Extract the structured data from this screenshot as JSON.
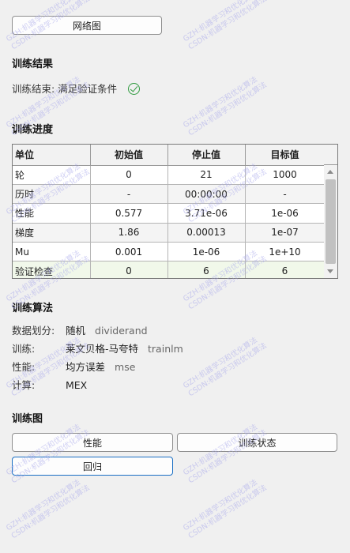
{
  "top_button": {
    "label": "网络图"
  },
  "results": {
    "title": "训练结果",
    "status": "训练结束: 满足验证条件"
  },
  "progress": {
    "title": "训练进度",
    "columns": [
      "单位",
      "初始值",
      "停止值",
      "目标值"
    ],
    "rows": [
      {
        "unit": "轮",
        "initial": "0",
        "stop": "21",
        "target": "1000"
      },
      {
        "unit": "历时",
        "initial": "-",
        "stop": "00:00:00",
        "target": "-"
      },
      {
        "unit": "性能",
        "initial": "0.577",
        "stop": "3.71e-06",
        "target": "1e-06"
      },
      {
        "unit": "梯度",
        "initial": "1.86",
        "stop": "0.00013",
        "target": "1e-07"
      },
      {
        "unit": "Mu",
        "initial": "0.001",
        "stop": "1e-06",
        "target": "1e+10"
      },
      {
        "unit": "验证检查",
        "initial": "0",
        "stop": "6",
        "target": "6"
      }
    ]
  },
  "algorithms": {
    "title": "训练算法",
    "items": [
      {
        "key": "数据划分:",
        "value": "随机",
        "method": "dividerand"
      },
      {
        "key": "训练:",
        "value": "莱文贝格-马夸特",
        "method": "trainlm"
      },
      {
        "key": "性能:",
        "value": "均方误差",
        "method": "mse"
      },
      {
        "key": "计算:",
        "value": "MEX",
        "method": ""
      }
    ]
  },
  "plots": {
    "title": "训练图",
    "performance_label": "性能",
    "train_state_label": "训练状态",
    "regression_label": "回归"
  },
  "watermark": {
    "line1": "GZH:机器学习和优化算法",
    "line2": "CSDN:机器学习和优化算法"
  },
  "colors": {
    "check": "#2e9a3e",
    "highlight_row": "#f1f8ea",
    "focus_border": "#1a6fc4"
  }
}
